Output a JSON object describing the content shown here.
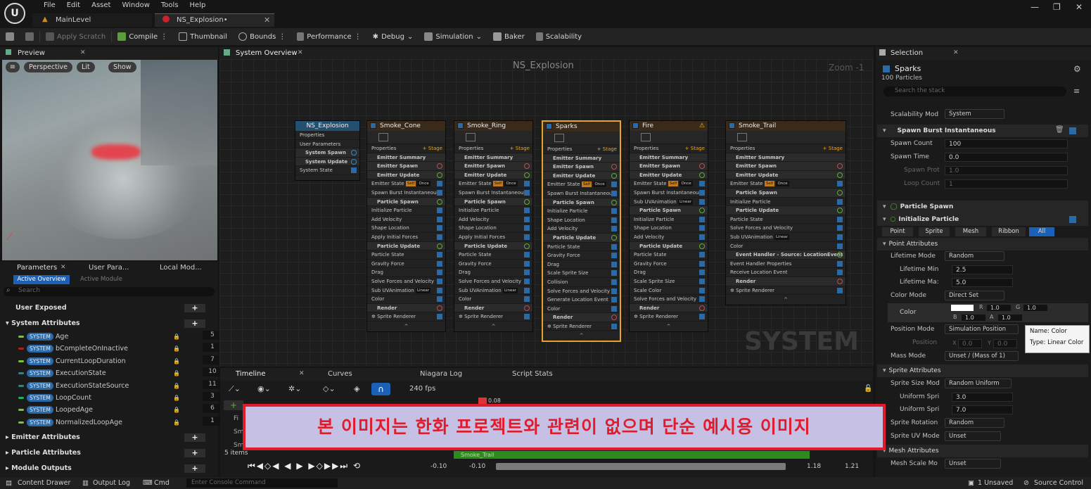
{
  "menubar": {
    "items": [
      "File",
      "Edit",
      "Asset",
      "Window",
      "Tools",
      "Help"
    ]
  },
  "tabs": [
    {
      "label": "MainLevel"
    },
    {
      "label": "NS_Explosion•"
    }
  ],
  "toolbar": {
    "save": "",
    "apply_scratch": "Apply Scratch",
    "compile": "Compile",
    "thumbnail": "Thumbnail",
    "bounds": "Bounds",
    "performance": "Performance",
    "debug": "Debug",
    "simulation": "Simulation",
    "baker": "Baker",
    "scalability": "Scalability"
  },
  "preview": {
    "tab": "Preview",
    "perspective": "Perspective",
    "lit": "Lit",
    "show": "Show"
  },
  "params": {
    "tabs": [
      "Parameters",
      "User Para...",
      "Local Mod..."
    ],
    "active_overview": "Active Overview",
    "active_module": "Active Module",
    "search": "Search",
    "user_exposed": "User Exposed",
    "system_attributes": "System Attributes",
    "system_badge": "SYSTEM",
    "items": [
      {
        "name": "Age",
        "value": "5",
        "color": "#7ec23a"
      },
      {
        "name": "bCompleteOnInactive",
        "value": "1",
        "color": "#b02020"
      },
      {
        "name": "CurrentLoopDuration",
        "value": "7",
        "color": "#7ec23a"
      },
      {
        "name": "ExecutionState",
        "value": "10",
        "color": "#1f8c8c"
      },
      {
        "name": "ExecutionStateSource",
        "value": "11",
        "color": "#1f8c8c"
      },
      {
        "name": "LoopCount",
        "value": "3",
        "color": "#20b060"
      },
      {
        "name": "LoopedAge",
        "value": "6",
        "color": "#7ec23a"
      },
      {
        "name": "NormalizedLoopAge",
        "value": "1",
        "color": "#7ec23a"
      }
    ],
    "emitter_attributes": "Emitter Attributes",
    "particle_attributes": "Particle Attributes",
    "module_outputs": "Module Outputs"
  },
  "graph": {
    "tab": "System Overview",
    "title": "NS_Explosion",
    "zoom": "Zoom -1",
    "watermark": "SYSTEM",
    "system_node": {
      "title": "NS_Explosion",
      "rows": [
        "Properties",
        "User Parameters",
        "System Spawn",
        "System Update",
        "System State"
      ]
    },
    "emitters": [
      {
        "title": "Smoke_Cone",
        "rows": [
          "Properties",
          "Emitter Summary",
          "Emitter Spawn",
          "Emitter Update",
          "Emitter State",
          "Spawn Burst Instantaneous",
          "Particle Spawn",
          "Initialize Particle",
          "Add Velocity",
          "Shape Location",
          "Apply Initial Forces",
          "Particle Update",
          "Particle State",
          "Gravity Force",
          "Drag",
          "Solve Forces and Velocity",
          "Sub UVAnimation",
          "Color",
          "Render",
          "Sprite Renderer"
        ]
      },
      {
        "title": "Smoke_Ring",
        "rows": [
          "Properties",
          "Emitter Summary",
          "Emitter Spawn",
          "Emitter Update",
          "Emitter State",
          "Spawn Burst Instantaneous",
          "Particle Spawn",
          "Initialize Particle",
          "Add Velocity",
          "Shape Location",
          "Apply Initial Forces",
          "Particle Update",
          "Particle State",
          "Gravity Force",
          "Drag",
          "Solve Forces and Velocity",
          "Sub UVAnimation",
          "Color",
          "Render",
          "Sprite Renderer"
        ]
      },
      {
        "title": "Sparks",
        "rows": [
          "Properties",
          "Emitter Summary",
          "Emitter Spawn",
          "Emitter Update",
          "Emitter State",
          "Spawn Burst Instantaneous",
          "Particle Spawn",
          "Initialize Particle",
          "Shape Location",
          "Add Velocity",
          "Particle Update",
          "Particle State",
          "Gravity Force",
          "Drag",
          "Scale Sprite Size",
          "Collision",
          "Solve Forces and Velocity",
          "Generate Location Event",
          "Color",
          "Render",
          "Sprite Renderer"
        ]
      },
      {
        "title": "Fire",
        "rows": [
          "Properties",
          "Emitter Summary",
          "Emitter Spawn",
          "Emitter Update",
          "Emitter State",
          "Spawn Burst Instantaneous",
          "Sub UVAnimation",
          "Particle Spawn",
          "Initialize Particle",
          "Shape Location",
          "Add Velocity",
          "Particle Update",
          "Particle State",
          "Gravity Force",
          "Drag",
          "Scale Sprite Size",
          "Scale Color",
          "Solve Forces and Velocity",
          "Render",
          "Sprite Renderer"
        ]
      },
      {
        "title": "Smoke_Trail",
        "rows": [
          "Properties",
          "Emitter Summary",
          "Emitter Spawn",
          "Emitter Update",
          "Emitter State",
          "Particle Spawn",
          "Initialize Particle",
          "Particle Update",
          "Particle State",
          "Solve Forces and Velocity",
          "Sub UVAnimation",
          "Color",
          "Event Handler - Source: LocationEvent",
          "Event Handler Properties",
          "Receive Location Event",
          "Render",
          "Sprite Renderer"
        ]
      }
    ],
    "stage": "Stage",
    "tag_self": "Self",
    "tag_once": "Once",
    "tag_cone": "In Cone",
    "tag_frompoint": "From Point",
    "tag_ring": "Ring / Disc",
    "tag_linear": "Linear",
    "tag_sphere": "Sphere"
  },
  "selection": {
    "tab": "Selection",
    "name": "Sparks",
    "count": "100 Particles",
    "search": "Search the stack",
    "scalability_mode_label": "Scalability Mod",
    "scalability_mode": "System",
    "spawn_burst": "Spawn Burst Instantaneous",
    "spawn_count_label": "Spawn Count",
    "spawn_count": "100",
    "spawn_time_label": "Spawn Time",
    "spawn_time": "0.0",
    "spawn_prob_label": "Spawn Prot",
    "spawn_prob": "1.0",
    "loop_count_label": "Loop Count",
    "loop_count": "1",
    "particle_spawn": "Particle Spawn",
    "initialize_particle": "Initialize Particle",
    "filters": [
      "Point",
      "Sprite",
      "Mesh",
      "Ribbon",
      "All"
    ],
    "point_attributes": "Point Attributes",
    "lifetime_mode_label": "Lifetime Mode",
    "lifetime_mode": "Random",
    "lifetime_min_label": "Lifetime Min",
    "lifetime_min": "2.5",
    "lifetime_max_label": "Lifetime Ma:",
    "lifetime_max": "5.0",
    "color_mode_label": "Color Mode",
    "color_mode": "Direct Set",
    "color_label": "Color",
    "r": "1.0",
    "g": "1.0",
    "b": "1.0",
    "a": "1.0",
    "position_mode_label": "Position Mode",
    "position_mode": "Simulation Position",
    "position_label": "Position",
    "pos_x": "0.0",
    "pos_y": "0.0",
    "mass_mode_label": "Mass Mode",
    "mass_mode": "Unset / (Mass of 1)",
    "sprite_attributes": "Sprite Attributes",
    "sprite_size_mode_label": "Sprite Size Mod",
    "sprite_size_mode": "Random Uniform",
    "uniform_min_label": "Uniform Spri",
    "uniform_min": "3.0",
    "uniform_max_label": "Uniform Spri",
    "uniform_max": "7.0",
    "sprite_rotation_label": "Sprite Rotation",
    "sprite_rotation": "Random",
    "sprite_uv_label": "Sprite UV Mode",
    "sprite_uv": "Unset",
    "mesh_attributes": "Mesh Attributes",
    "mesh_scale_label": "Mesh Scale Mo",
    "mesh_scale": "Unset"
  },
  "tooltip": {
    "name": "Name: Color",
    "type": "Type: Linear Color"
  },
  "timeline": {
    "tabs": [
      "Timeline",
      "Curves",
      "Niagara Log",
      "Script Stats"
    ],
    "fps": "240 fps",
    "time": "0.08",
    "items": "5 items",
    "t1": "-0.10",
    "t2": "-0.10",
    "t3": "1.18",
    "t4": "1.21",
    "track": "Smoke_Trail"
  },
  "banner": "본 이미지는 한화 프로젝트와 관련이 없으며 단순 예시용 이미지",
  "statusbar": {
    "content_drawer": "Content Drawer",
    "output_log": "Output Log",
    "cmd": "Cmd",
    "console": "Enter Console Command",
    "unsaved": "1 Unsaved",
    "source_control": "Source Control"
  }
}
